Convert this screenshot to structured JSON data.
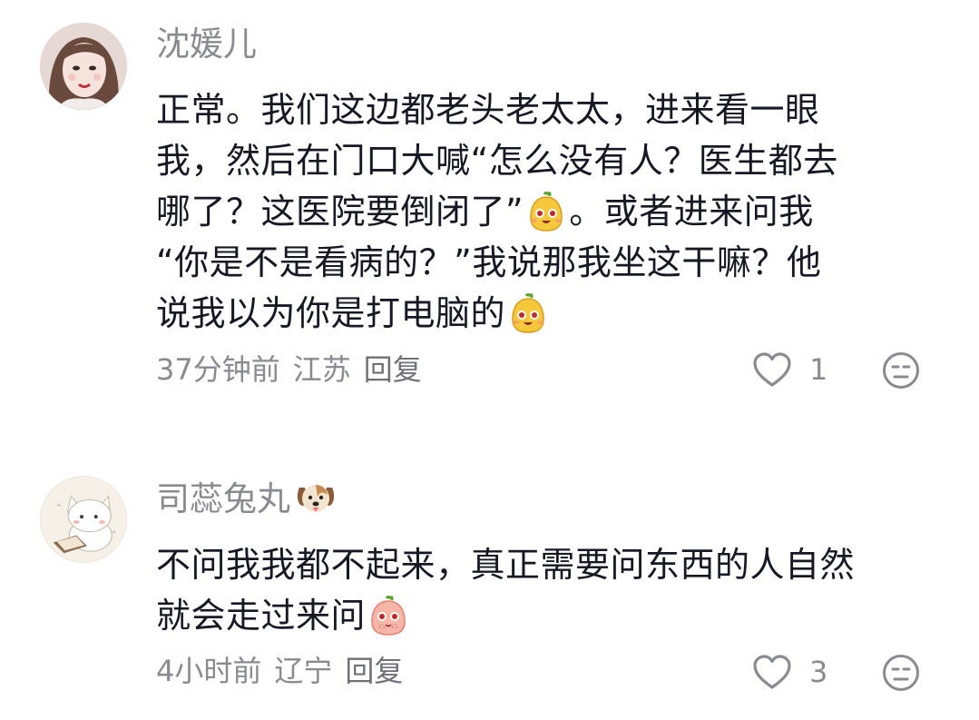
{
  "comments": [
    {
      "username": "沈媛儿",
      "lines": [
        {
          "before": "正常。我们这边都老头老太太，进来看一眼",
          "after": ""
        },
        {
          "before": "我，然后在门口大喊“怎么没有人？医生都去",
          "after": ""
        },
        {
          "before": "哪了？这医院要倒闭了”",
          "after": "。或者进来问我"
        },
        {
          "before": "“你是不是看病的？”我说那我坐这干嘛？他",
          "after": ""
        },
        {
          "before": "说我以为你是打电脑的",
          "after": ""
        }
      ],
      "time": "37分钟前",
      "location": "江苏",
      "reply_label": "回复",
      "like_count": "1",
      "icons": {
        "like": "heart-outline-icon",
        "dislike": "dislike-face-icon",
        "emoji": "yellow-grinning-emoji"
      }
    },
    {
      "username": "司蕊兔丸",
      "lines": [
        {
          "before": "不问我我都不起来，真正需要问东西的人自然",
          "after": ""
        },
        {
          "before": "就会走过来问",
          "after": ""
        }
      ],
      "time": "4小时前",
      "location": "辽宁",
      "reply_label": "回复",
      "like_count": "3",
      "icons": {
        "like": "heart-outline-icon",
        "dislike": "dislike-face-icon",
        "emoji": "pink-pleading-emoji",
        "name_emoji": "dog-face-emoji"
      }
    }
  ],
  "colors": {
    "text": "#161823",
    "secondary": "#8a8b91",
    "background": "#ffffff"
  }
}
